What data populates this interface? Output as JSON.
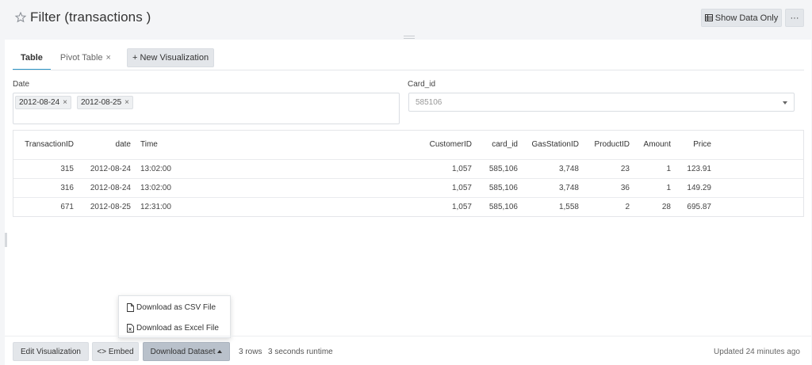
{
  "header": {
    "title": "Filter (transactions )",
    "show_data_label": "Show Data Only",
    "more_label": "···"
  },
  "tabs": {
    "items": [
      {
        "label": "Table",
        "active": true
      },
      {
        "label": "Pivot Table",
        "active": false,
        "close": "×"
      }
    ],
    "new_visualization": "+ New Visualization"
  },
  "filters": {
    "date_label": "Date",
    "date_values": [
      {
        "label": "2012-08-24",
        "remove": "×"
      },
      {
        "label": "2012-08-25",
        "remove": "×"
      }
    ],
    "card_label": "Card_id",
    "card_value": "585106"
  },
  "table": {
    "columns": [
      "TransactionID",
      "date",
      "Time",
      "CustomerID",
      "card_id",
      "GasStationID",
      "ProductID",
      "Amount",
      "Price"
    ],
    "rows": [
      [
        "315",
        "2012-08-24",
        "13:02:00",
        "1,057",
        "585,106",
        "3,748",
        "23",
        "1",
        "123.91"
      ],
      [
        "316",
        "2012-08-24",
        "13:02:00",
        "1,057",
        "585,106",
        "3,748",
        "36",
        "1",
        "149.29"
      ],
      [
        "671",
        "2012-08-25",
        "12:31:00",
        "1,057",
        "585,106",
        "1,558",
        "2",
        "28",
        "695.87"
      ]
    ]
  },
  "download_menu": {
    "csv": "Download as CSV File",
    "excel": "Download as Excel File"
  },
  "footer": {
    "edit": "Edit Visualization",
    "embed": "<> Embed",
    "download": "Download Dataset",
    "rows": "3 rows",
    "runtime": "3 seconds runtime",
    "updated": "Updated 24 minutes ago"
  },
  "colors": {
    "accent": "#2c95c6",
    "page_bg": "#f4f5f7",
    "button_bg": "#e3e6ea",
    "active_button_bg": "#b9c1cb"
  },
  "icons": {
    "favorite": "star-outline-icon",
    "show_data": "table-icon",
    "file": "file-icon",
    "caret": "caret-icon"
  }
}
